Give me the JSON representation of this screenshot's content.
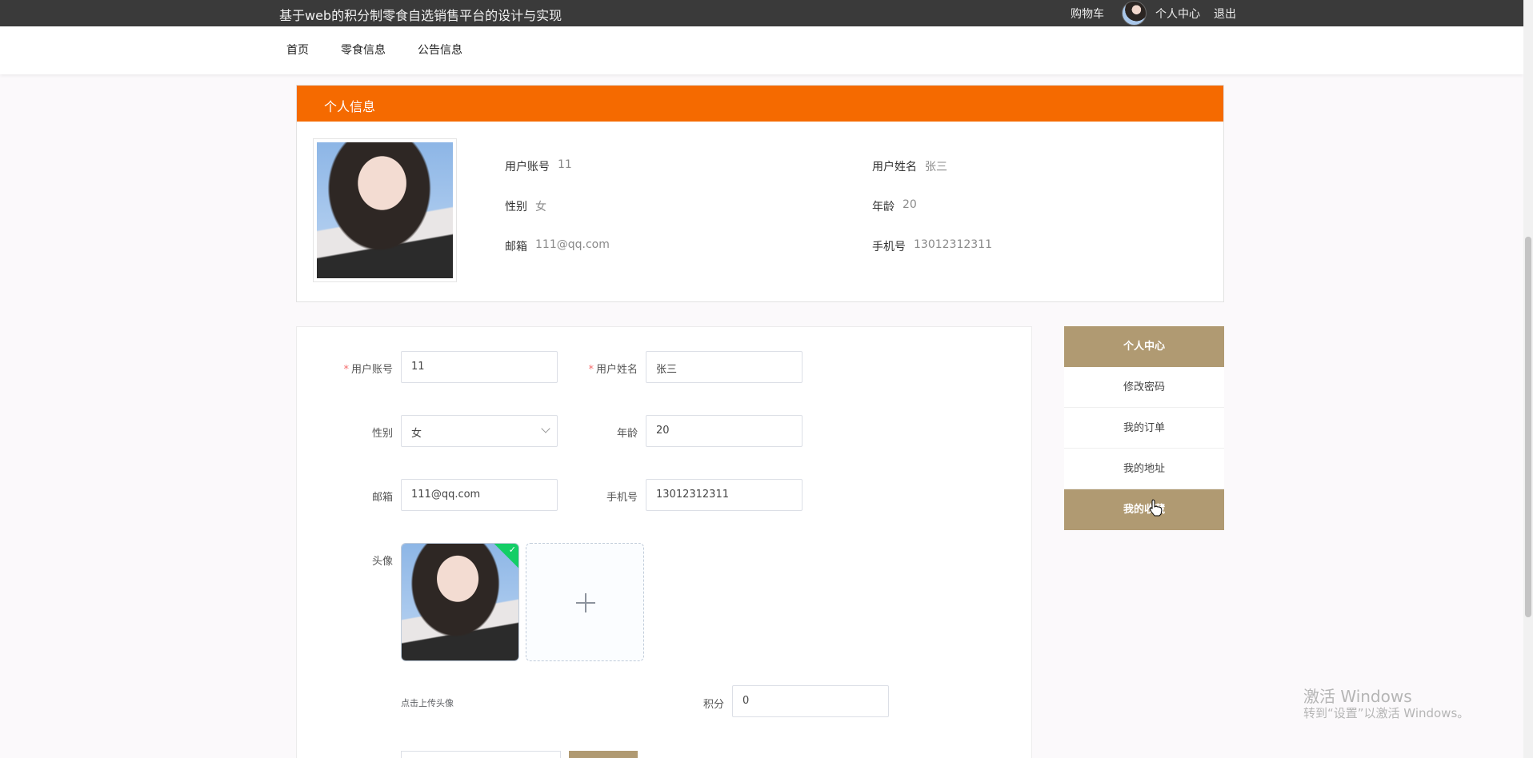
{
  "header": {
    "site_title": "基于web的积分制零食自选销售平台的设计与实现",
    "cart": "购物车",
    "user_center": "个人中心",
    "logout": "退出"
  },
  "nav": {
    "items": [
      "首页",
      "零食信息",
      "公告信息"
    ]
  },
  "profile_card": {
    "title": "个人信息",
    "fields": [
      {
        "label": "用户账号",
        "value": "11"
      },
      {
        "label": "用户姓名",
        "value": "张三"
      },
      {
        "label": "性别",
        "value": "女"
      },
      {
        "label": "年龄",
        "value": "20"
      },
      {
        "label": "邮箱",
        "value": "111@qq.com"
      },
      {
        "label": "手机号",
        "value": "13012312311"
      }
    ]
  },
  "form": {
    "account": {
      "label": "用户账号",
      "value": "11"
    },
    "name": {
      "label": "用户姓名",
      "value": "张三"
    },
    "gender": {
      "label": "性别",
      "value": "女"
    },
    "age": {
      "label": "年龄",
      "value": "20"
    },
    "email": {
      "label": "邮箱",
      "value": "111@qq.com"
    },
    "phone": {
      "label": "手机号",
      "value": "13012312311"
    },
    "avatar": {
      "label": "头像",
      "hint": "点击上传头像"
    },
    "points": {
      "label": "积分",
      "value": "0"
    },
    "required_mark": "*"
  },
  "side_menu": {
    "items": [
      "个人中心",
      "修改密码",
      "我的订单",
      "我的地址",
      "我的收藏"
    ],
    "active_index": 0,
    "hover_index": 4,
    "accent_color": "#b09a72"
  },
  "watermark": {
    "line1": "激活 Windows",
    "line2": "转到“设置”以激活 Windows。"
  }
}
